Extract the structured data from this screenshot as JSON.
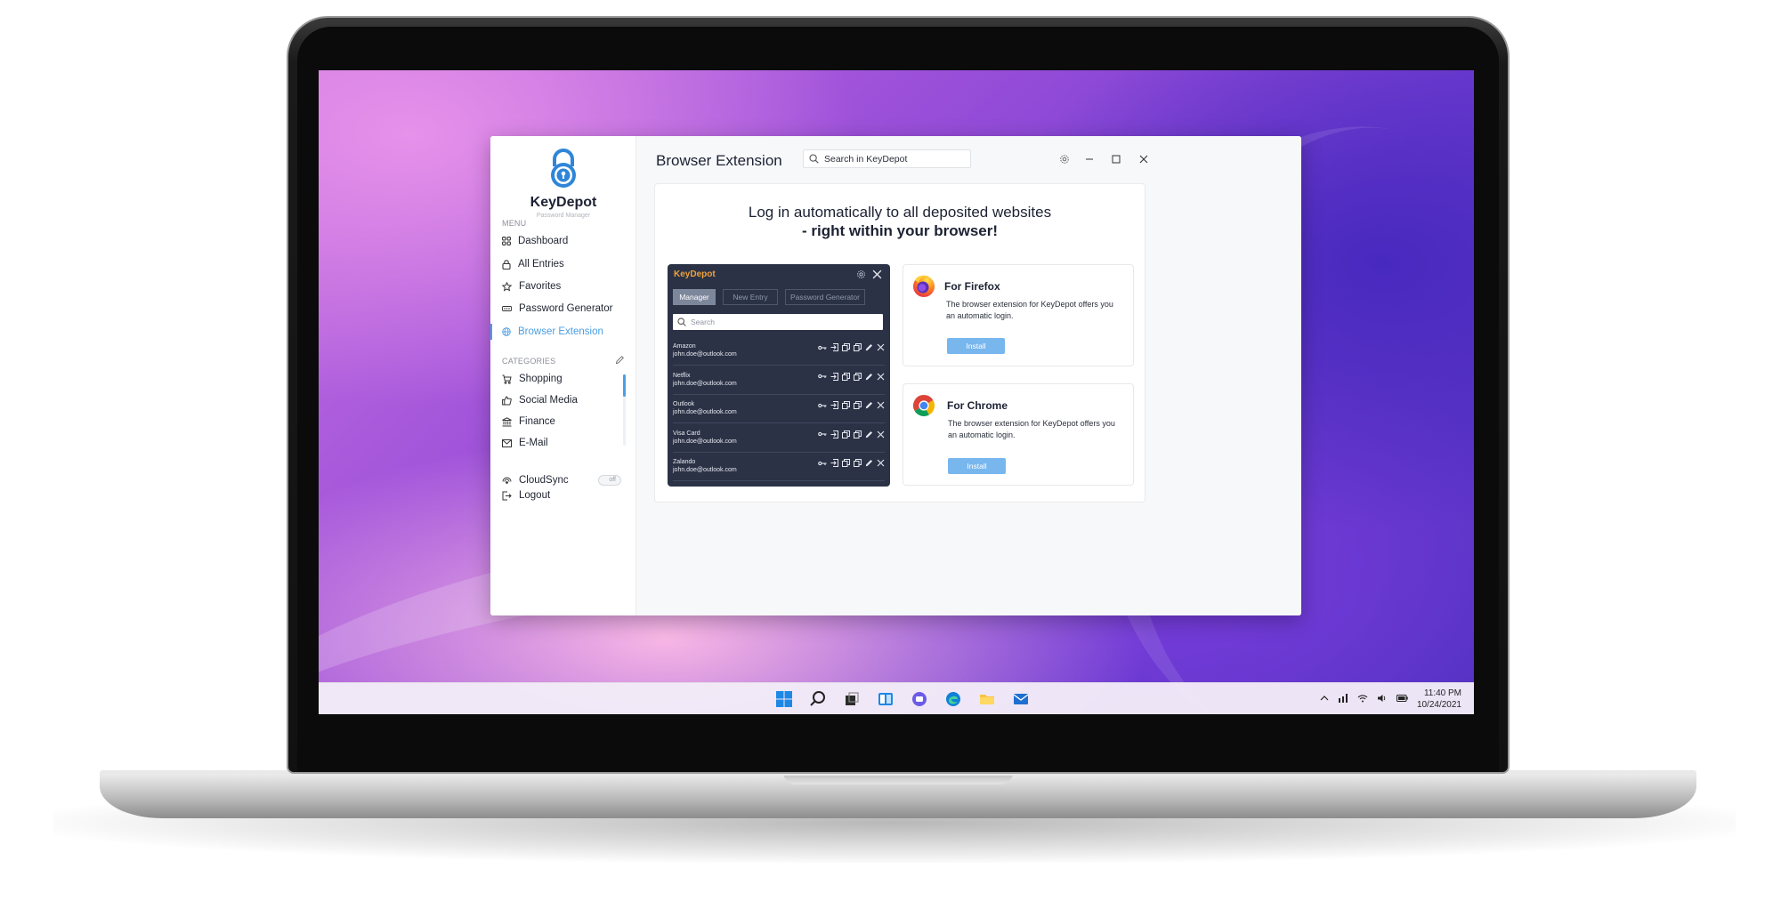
{
  "app": {
    "name": "KeyDepot",
    "subtitle": "Password Manager",
    "accent_color": "#4a9ee4"
  },
  "sidebar": {
    "menu_label": "MENU",
    "menu_items": [
      {
        "label": "Dashboard",
        "icon": "grid-icon"
      },
      {
        "label": "All Entries",
        "icon": "lock-icon"
      },
      {
        "label": "Favorites",
        "icon": "star-icon"
      },
      {
        "label": "Password Generator",
        "icon": "password-dots-icon"
      },
      {
        "label": "Browser Extension",
        "icon": "globe-icon",
        "active": true
      }
    ],
    "categories_label": "CATEGORIES",
    "categories": [
      {
        "label": "Shopping",
        "icon": "cart-icon"
      },
      {
        "label": "Social Media",
        "icon": "thumbs-up-icon"
      },
      {
        "label": "Finance",
        "icon": "bank-icon"
      },
      {
        "label": "E-Mail",
        "icon": "envelope-icon"
      }
    ],
    "cloudsync_label": "CloudSync",
    "cloudsync_state": "off",
    "logout_label": "Logout"
  },
  "header": {
    "title": "Browser Extension",
    "search_placeholder": "Search in KeyDepot"
  },
  "content": {
    "headline_line1": "Log in automatically to all deposited websites",
    "headline_line2": "- right within your browser!",
    "popup": {
      "title": "KeyDepot",
      "title_color": "#f0a13a",
      "tabs": [
        "Manager",
        "New Entry",
        "Password Generator"
      ],
      "active_tab": "Manager",
      "search_placeholder": "Search",
      "entries": [
        {
          "name": "Amazon",
          "email": "john.doe@outlook.com"
        },
        {
          "name": "Netflix",
          "email": "john.doe@outlook.com"
        },
        {
          "name": "Outlook",
          "email": "john.doe@outlook.com"
        },
        {
          "name": "Visa Card",
          "email": "john.doe@outlook.com"
        },
        {
          "name": "Zalando",
          "email": "john.doe@outlook.com"
        }
      ]
    },
    "firefox": {
      "title": "For Firefox",
      "text": "The browser extension for KeyDepot offers you an automatic login.",
      "button": "Install"
    },
    "chrome": {
      "title": "For Chrome",
      "text": "The browser extension for KeyDepot offers you an automatic login.",
      "button": "Install"
    }
  },
  "taskbar": {
    "time": "11:40 PM",
    "date": "10/24/2021"
  }
}
